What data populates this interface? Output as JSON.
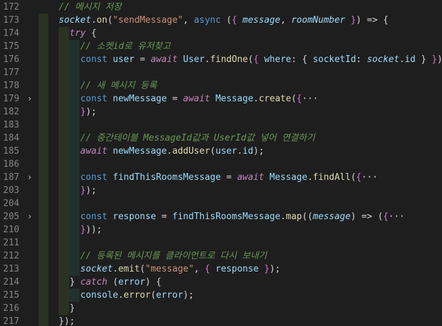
{
  "editor": {
    "lines": [
      {
        "num": "172",
        "fold": "",
        "tokens": [
          {
            "t": "// 메시지 저장",
            "c": "comment"
          }
        ]
      },
      {
        "num": "173",
        "fold": "",
        "tokens": [
          {
            "t": "socket",
            "c": "var-i"
          },
          {
            "t": ".",
            "c": "punc"
          },
          {
            "t": "on",
            "c": "fn"
          },
          {
            "t": "(",
            "c": "punc"
          },
          {
            "t": "\"sendMessage\"",
            "c": "str"
          },
          {
            "t": ", ",
            "c": "punc"
          },
          {
            "t": "async",
            "c": "kw"
          },
          {
            "t": " (",
            "c": "punc"
          },
          {
            "t": "{",
            "c": "brace"
          },
          {
            "t": " message",
            "c": "var-i"
          },
          {
            "t": ", ",
            "c": "punc"
          },
          {
            "t": "roomNumber",
            "c": "var-i"
          },
          {
            "t": " }",
            "c": "brace"
          },
          {
            "t": ") => {",
            "c": "punc"
          }
        ]
      },
      {
        "num": "174",
        "fold": "",
        "tokens": [
          {
            "t": "  try",
            "c": "kw2"
          },
          {
            "t": " {",
            "c": "punc"
          }
        ]
      },
      {
        "num": "175",
        "fold": "",
        "tokens": [
          {
            "t": "    // 소켓id로 유저찾고",
            "c": "comment"
          }
        ]
      },
      {
        "num": "176",
        "fold": "",
        "tokens": [
          {
            "t": "    const",
            "c": "kw"
          },
          {
            "t": " user",
            "c": "var"
          },
          {
            "t": " = ",
            "c": "punc"
          },
          {
            "t": "await",
            "c": "kw2"
          },
          {
            "t": " User",
            "c": "var"
          },
          {
            "t": ".",
            "c": "punc"
          },
          {
            "t": "findOne",
            "c": "fn"
          },
          {
            "t": "(",
            "c": "punc"
          },
          {
            "t": "{",
            "c": "brace"
          },
          {
            "t": " where",
            "c": "var"
          },
          {
            "t": ": { ",
            "c": "punc"
          },
          {
            "t": "socketId",
            "c": "var"
          },
          {
            "t": ": ",
            "c": "punc"
          },
          {
            "t": "socket",
            "c": "var-i"
          },
          {
            "t": ".",
            "c": "punc"
          },
          {
            "t": "id",
            "c": "var"
          },
          {
            "t": " } ",
            "c": "punc"
          },
          {
            "t": "}",
            "c": "brace"
          },
          {
            "t": ");",
            "c": "punc"
          }
        ]
      },
      {
        "num": "177",
        "fold": "",
        "tokens": []
      },
      {
        "num": "178",
        "fold": "",
        "tokens": [
          {
            "t": "    // 새 메시지 등록",
            "c": "comment"
          }
        ]
      },
      {
        "num": "179",
        "fold": "›",
        "tokens": [
          {
            "t": "    const",
            "c": "kw"
          },
          {
            "t": " newMessage",
            "c": "var"
          },
          {
            "t": " = ",
            "c": "punc"
          },
          {
            "t": "await",
            "c": "kw2"
          },
          {
            "t": " Message",
            "c": "var"
          },
          {
            "t": ".",
            "c": "punc"
          },
          {
            "t": "create",
            "c": "fn"
          },
          {
            "t": "(",
            "c": "punc"
          },
          {
            "t": "{",
            "c": "brace"
          },
          {
            "t": "···",
            "c": "punc"
          }
        ]
      },
      {
        "num": "182",
        "fold": "",
        "tokens": [
          {
            "t": "    ",
            "c": "punc"
          },
          {
            "t": "}",
            "c": "brace"
          },
          {
            "t": ");",
            "c": "punc"
          }
        ]
      },
      {
        "num": "183",
        "fold": "",
        "tokens": []
      },
      {
        "num": "184",
        "fold": "",
        "tokens": [
          {
            "t": "    // 중간테이블 MessageId값과 UserId값 넣어 연결하기",
            "c": "comment"
          }
        ]
      },
      {
        "num": "185",
        "fold": "",
        "tokens": [
          {
            "t": "    await",
            "c": "kw2"
          },
          {
            "t": " newMessage",
            "c": "var"
          },
          {
            "t": ".",
            "c": "punc"
          },
          {
            "t": "addUser",
            "c": "fn"
          },
          {
            "t": "(",
            "c": "punc"
          },
          {
            "t": "user",
            "c": "var"
          },
          {
            "t": ".",
            "c": "punc"
          },
          {
            "t": "id",
            "c": "var"
          },
          {
            "t": ");",
            "c": "punc"
          }
        ]
      },
      {
        "num": "186",
        "fold": "",
        "tokens": []
      },
      {
        "num": "187",
        "fold": "›",
        "tokens": [
          {
            "t": "    const",
            "c": "kw"
          },
          {
            "t": " findThisRoomsMessage",
            "c": "var"
          },
          {
            "t": " = ",
            "c": "punc"
          },
          {
            "t": "await",
            "c": "kw2"
          },
          {
            "t": " Message",
            "c": "var"
          },
          {
            "t": ".",
            "c": "punc"
          },
          {
            "t": "findAll",
            "c": "fn"
          },
          {
            "t": "(",
            "c": "punc"
          },
          {
            "t": "{",
            "c": "brace"
          },
          {
            "t": "···",
            "c": "punc"
          }
        ]
      },
      {
        "num": "203",
        "fold": "",
        "tokens": [
          {
            "t": "    ",
            "c": "punc"
          },
          {
            "t": "}",
            "c": "brace"
          },
          {
            "t": ");",
            "c": "punc"
          }
        ]
      },
      {
        "num": "204",
        "fold": "",
        "tokens": []
      },
      {
        "num": "205",
        "fold": "›",
        "tokens": [
          {
            "t": "    const",
            "c": "kw"
          },
          {
            "t": " response",
            "c": "var"
          },
          {
            "t": " = ",
            "c": "punc"
          },
          {
            "t": "findThisRoomsMessage",
            "c": "var"
          },
          {
            "t": ".",
            "c": "punc"
          },
          {
            "t": "map",
            "c": "fn"
          },
          {
            "t": "((",
            "c": "punc"
          },
          {
            "t": "message",
            "c": "var-i"
          },
          {
            "t": ") => (",
            "c": "punc"
          },
          {
            "t": "{",
            "c": "brace"
          },
          {
            "t": "···",
            "c": "punc"
          }
        ]
      },
      {
        "num": "210",
        "fold": "",
        "tokens": [
          {
            "t": "    ",
            "c": "punc"
          },
          {
            "t": "}",
            "c": "brace"
          },
          {
            "t": "));",
            "c": "punc"
          }
        ]
      },
      {
        "num": "211",
        "fold": "",
        "tokens": []
      },
      {
        "num": "212",
        "fold": "",
        "tokens": [
          {
            "t": "    // 등록된 메시지를 클라이언트로 다시 보내기",
            "c": "comment"
          }
        ]
      },
      {
        "num": "213",
        "fold": "",
        "tokens": [
          {
            "t": "    socket",
            "c": "var-i"
          },
          {
            "t": ".",
            "c": "punc"
          },
          {
            "t": "emit",
            "c": "fn"
          },
          {
            "t": "(",
            "c": "punc"
          },
          {
            "t": "\"message\"",
            "c": "str"
          },
          {
            "t": ", ",
            "c": "punc"
          },
          {
            "t": "{",
            "c": "brace"
          },
          {
            "t": " response",
            "c": "var"
          },
          {
            "t": " ",
            "c": "punc"
          },
          {
            "t": "}",
            "c": "brace"
          },
          {
            "t": ");",
            "c": "punc"
          }
        ]
      },
      {
        "num": "214",
        "fold": "",
        "tokens": [
          {
            "t": "  } ",
            "c": "punc"
          },
          {
            "t": "catch",
            "c": "kw2"
          },
          {
            "t": " (",
            "c": "punc"
          },
          {
            "t": "error",
            "c": "var"
          },
          {
            "t": ") {",
            "c": "punc"
          }
        ]
      },
      {
        "num": "215",
        "fold": "",
        "tokens": [
          {
            "t": "    console",
            "c": "var"
          },
          {
            "t": ".",
            "c": "punc"
          },
          {
            "t": "error",
            "c": "fn"
          },
          {
            "t": "(",
            "c": "punc"
          },
          {
            "t": "error",
            "c": "var"
          },
          {
            "t": ");",
            "c": "punc"
          }
        ]
      },
      {
        "num": "216",
        "fold": "",
        "tokens": [
          {
            "t": "  }",
            "c": "punc"
          }
        ]
      },
      {
        "num": "217",
        "fold": "",
        "tokens": [
          {
            "t": "});",
            "c": "punc"
          }
        ]
      }
    ]
  },
  "colors": {
    "background": "#1e1e1e",
    "line_number": "#858585",
    "comment": "#6a9955",
    "keyword": "#569cd6",
    "control_keyword": "#c586c0",
    "variable": "#9cdcfe",
    "function": "#dcdcaa",
    "string": "#ce9178",
    "brace": "#da70d6",
    "indent_band_1": "#2a3222",
    "indent_band_2": "#22302e"
  }
}
